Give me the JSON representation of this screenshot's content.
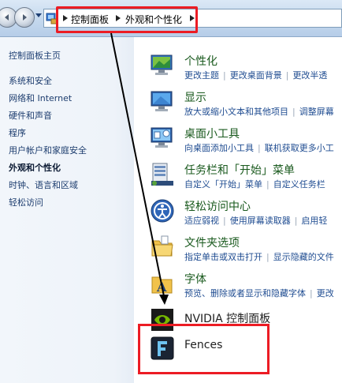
{
  "breadcrumb": {
    "level1": "控制面板",
    "level2": "外观和个性化"
  },
  "left_nav": {
    "home": "控制面板主页",
    "items": [
      "系统和安全",
      "网络和 Internet",
      "硬件和声音",
      "程序",
      "用户帐户和家庭安全",
      "外观和个性化",
      "时钟、语言和区域",
      "轻松访问"
    ],
    "current_index": 5
  },
  "entries": [
    {
      "title": "个性化",
      "links": [
        "更改主题",
        "更改桌面背景",
        "更改半透"
      ],
      "icon": "personalization-icon"
    },
    {
      "title": "显示",
      "links": [
        "放大或缩小文本和其他项目",
        "调整屏幕"
      ],
      "icon": "display-icon"
    },
    {
      "title": "桌面小工具",
      "links": [
        "向桌面添加小工具",
        "联机获取更多小工"
      ],
      "icon": "desktop-gadgets-icon"
    },
    {
      "title": "任务栏和「开始」菜单",
      "links": [
        "自定义「开始」菜单",
        "自定义任务栏"
      ],
      "icon": "taskbar-start-icon"
    },
    {
      "title": "轻松访问中心",
      "links": [
        "适应弱视",
        "使用屏幕读取器",
        "启用轻"
      ],
      "icon": "ease-of-access-icon"
    },
    {
      "title": "文件夹选项",
      "links": [
        "指定单击或双击打开",
        "显示隐藏的文件"
      ],
      "icon": "folder-options-icon"
    },
    {
      "title": "字体",
      "links": [
        "预览、删除或者显示和隐藏字体",
        "更改"
      ],
      "icon": "fonts-icon"
    },
    {
      "title": "NVIDIA 控制面板",
      "links": [],
      "icon": "nvidia-icon"
    },
    {
      "title": "Fences",
      "links": [],
      "icon": "fences-icon"
    }
  ],
  "colors": {
    "highlight": "#ec1c24",
    "title_green": "#1a5a1e",
    "link_blue": "#1f4c91"
  }
}
